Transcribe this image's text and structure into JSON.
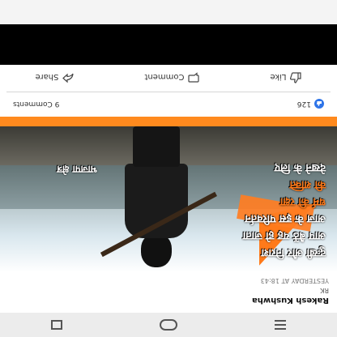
{
  "post": {
    "author": "Rakesh Kushwha",
    "subtitle": "RK",
    "time": "YESTERDAY AT 18:43",
    "image": {
      "caption_lines": [
        "दुःखी और निराश",
        "आप बैठें यह हो जाता",
        "आज के इस परिवर्तन",
        "धर्म की रक्षा",
        "की शक्ति",
        "देखने के लिए"
      ],
      "name_tag": "भाजपा क्षेत्र"
    },
    "likes_count": "126",
    "comments_count": "9 Comments"
  },
  "actions": {
    "like": "Like",
    "comment": "Comment",
    "share": "Share"
  },
  "colors": {
    "accent": "#ff7a1a",
    "like_blue": "#2e74e8"
  },
  "icons": {
    "like": "thumbs-up-icon",
    "comment": "comment-bubble-icon",
    "share": "share-arrow-icon",
    "menu": "menu-icon",
    "home": "home-icon",
    "overflow": "more-vertical-icon",
    "like_badge": "like-badge-icon"
  }
}
